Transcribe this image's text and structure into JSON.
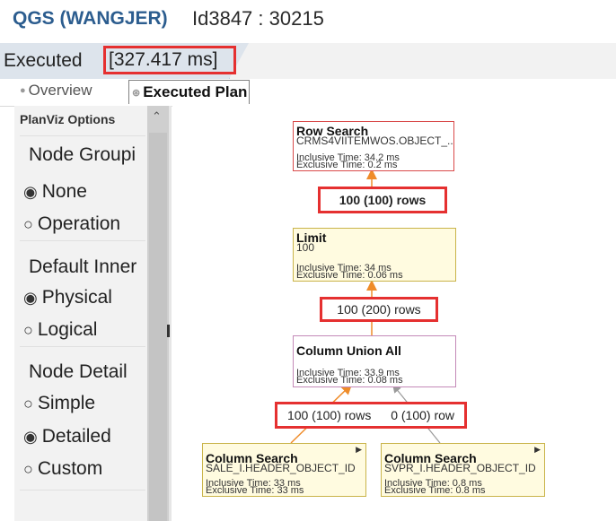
{
  "header": {
    "app_title": "QGS (WANGJER)",
    "connection": "Id3847 : 30215"
  },
  "status": {
    "label": "Executed",
    "time": "[327.417 ms]"
  },
  "tabs": [
    {
      "label": "Overview",
      "icon": "overview-icon"
    },
    {
      "label": "Executed Plan",
      "icon": "plan-icon"
    }
  ],
  "sidebar": {
    "title": "PlanViz Options",
    "sections": [
      {
        "label": "Node Groupi",
        "options": [
          "None",
          "Operation"
        ],
        "selected": "None"
      },
      {
        "label": "Default Inner",
        "options": [
          "Physical",
          "Logical"
        ],
        "selected": "Physical"
      },
      {
        "label": "Node Detail",
        "options": [
          "Simple",
          "Detailed",
          "Custom"
        ],
        "selected": "Detailed"
      }
    ]
  },
  "plan": {
    "nodes": {
      "row_search": {
        "title": "Row Search",
        "subtitle": "CRMS4VIITEMWOS.OBJECT_...",
        "inclusive": "Inclusive Time: 34.2 ms",
        "exclusive": "Exclusive Time: 0.2 ms"
      },
      "limit": {
        "title": "Limit",
        "subtitle": "100",
        "inclusive": "Inclusive Time: 34 ms",
        "exclusive": "Exclusive Time: 0.06 ms"
      },
      "union_all": {
        "title": "Column Union All",
        "subtitle": "",
        "inclusive": "Inclusive Time: 33.9 ms",
        "exclusive": "Exclusive Time: 0.08 ms"
      },
      "col_search_1": {
        "title": "Column Search",
        "subtitle": "SALE_I.HEADER_OBJECT_ID",
        "inclusive": "Inclusive Time: 33 ms",
        "exclusive": "Exclusive Time: 33 ms"
      },
      "col_search_2": {
        "title": "Column Search",
        "subtitle": "SVPR_I.HEADER_OBJECT_ID",
        "inclusive": "Inclusive Time: 0.8 ms",
        "exclusive": "Exclusive Time: 0.8 ms"
      }
    },
    "edges": {
      "limit_to_row": "100 (100) rows",
      "union_to_limit": "100 (200) rows",
      "col1_to_union": "100 (100) rows",
      "col2_to_union": "0 (100) row"
    }
  },
  "colors": {
    "title_blue": "#2c5d8f",
    "highlight_red": "#e53030",
    "node_red_border": "#d94a4a",
    "node_yellow_border": "#c9b44a",
    "node_pink_border": "#c48ab8",
    "node_yellow_fill": "#fffbe0",
    "arrow_orange": "#ef8c2a",
    "arrow_gray": "#9a9a9a"
  }
}
